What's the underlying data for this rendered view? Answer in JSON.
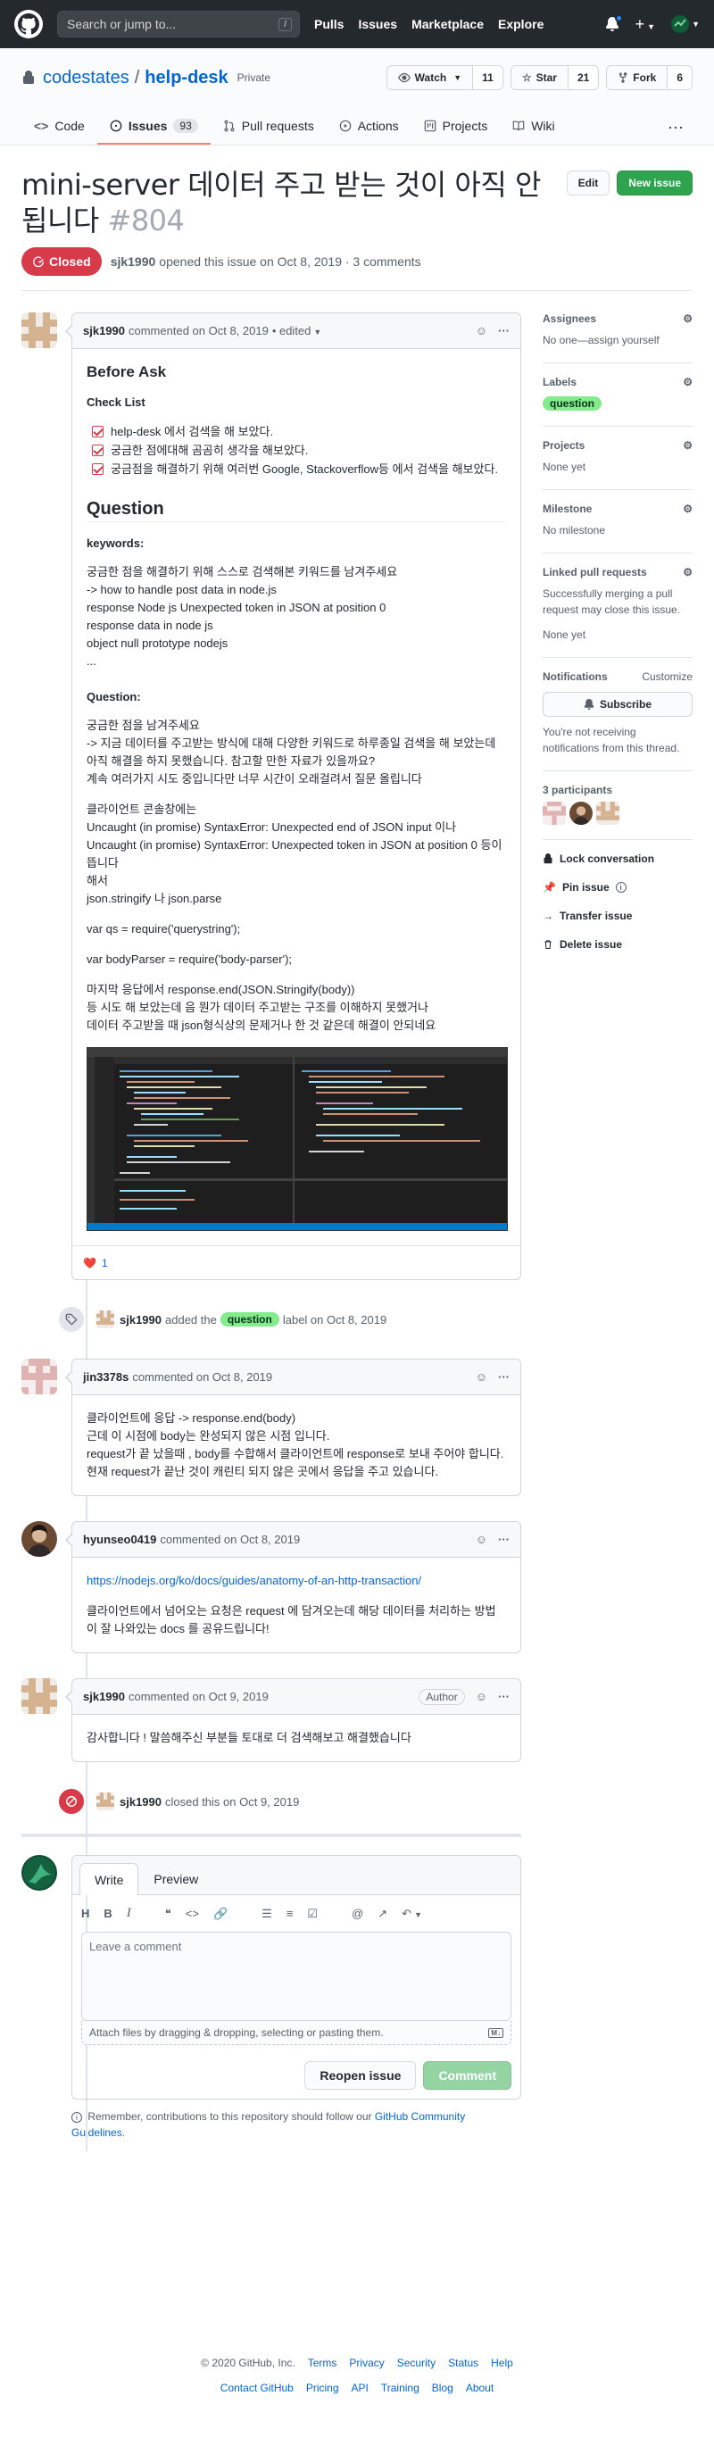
{
  "header": {
    "search_placeholder": "Search or jump to...",
    "slash_key": "/",
    "nav": [
      "Pulls",
      "Issues",
      "Marketplace",
      "Explore"
    ]
  },
  "repo": {
    "owner": "codestates",
    "separator": "/",
    "name": "help-desk",
    "visibility": "Private",
    "watch_label": "Watch",
    "watch_count": "11",
    "star_label": "Star",
    "star_count": "21",
    "fork_label": "Fork",
    "fork_count": "6",
    "tabs": [
      {
        "label": "Code",
        "icon": "code-icon"
      },
      {
        "label": "Issues",
        "icon": "issue-opened-icon",
        "count": "93"
      },
      {
        "label": "Pull requests",
        "icon": "pull-request-icon"
      },
      {
        "label": "Actions",
        "icon": "play-icon"
      },
      {
        "label": "Projects",
        "icon": "project-icon"
      },
      {
        "label": "Wiki",
        "icon": "book-icon"
      }
    ]
  },
  "issue": {
    "title": "mini-server 데이터 주고 받는 것이 아직 안됩니다",
    "number": "#804",
    "edit_label": "Edit",
    "new_issue_label": "New issue",
    "state": "Closed",
    "author": "sjk1990",
    "meta": "opened this issue on Oct 8, 2019 · 3 comments"
  },
  "first_comment": {
    "user": "sjk1990",
    "meta": "commented on Oct 8, 2019",
    "edited": "• edited",
    "before_ask": "Before Ask",
    "check_list_title": "Check List",
    "checks": [
      "help-desk 에서 검색을 해 보았다.",
      "궁금한 점에대해 곰곰히 생각을 해보았다.",
      "궁금점을 해결하기 위해 여러번 Google, Stackoverflow등 에서 검색을 해보았다."
    ],
    "question_heading": "Question",
    "keywords_title": "keywords:",
    "keywords_lines": [
      "궁금한 점을 해결하기 위해 스스로 검색해본 키워드를 남겨주세요",
      "-> how to handle post data in node.js",
      "response Node js Unexpected token in JSON at position 0",
      "response data in node js",
      "object null prototype nodejs",
      "..."
    ],
    "question_title": "Question:",
    "question_lines": [
      "궁금한 점을 남겨주세요",
      "-> 지금 데이터를 주고받는 방식에 대해 다양한 키워드로 하루종일 검색을 해 보았는데 아직 해결을 하지 못했습니다. 참고할 만한 자료가 있을까요?",
      "계속 여러가지 시도 중입니다만 너무 시간이 오래걸려서 질문 올립니다"
    ],
    "client_lines": [
      "클라이언트 콘솔창에는",
      "Uncaught (in promise) SyntaxError: Unexpected end of JSON input 이나",
      "Uncaught (in promise) SyntaxError: Unexpected token in JSON at position 0 등이 뜹니다",
      "해서",
      "json.stringify 나 json.parse"
    ],
    "qs_line": "var qs = require('querystring');",
    "bodyparser_line": "var bodyParser = require('body-parser');",
    "final_lines": [
      "마지막 응답에서 response.end(JSON.Stringify(body))",
      "등 시도 해 보았는데 음 뭔가 데이터 주고받는 구조를 이해하지 못했거나",
      "데이터 주고받을 때 json형식상의 문제거나 한 것 같은데 해결이 안되네요"
    ],
    "reaction_emoji": "❤️",
    "reaction_count": "1"
  },
  "label_event": {
    "user": "sjk1990",
    "text_before": "added the",
    "label": "question",
    "text_after": "label on Oct 8, 2019"
  },
  "comment2": {
    "user": "jin3378s",
    "meta": "commented on Oct 8, 2019",
    "lines": [
      "클라이언트에 응답 -> response.end(body)",
      "근데 이 시점에 body는 완성되지 않은 시점 입니다.",
      "request가 끝 났을때 , body를 수합해서 클라이언트에 response로 보내 주어야 합니다.",
      "현재 request가 끝난 것이 캐린티 되지 않은 곳에서 응답을 주고 있습니다."
    ]
  },
  "comment3": {
    "user": "hyunseo0419",
    "meta": "commented on Oct 8, 2019",
    "link": "https://nodejs.org/ko/docs/guides/anatomy-of-an-http-transaction/",
    "text": "클라이언트에서 넘어오는 요청은 request 에 담겨오는데 해당 데이터를 처리하는 방법이 잘 나와있는 docs 를 공유드립니다!"
  },
  "comment4": {
    "user": "sjk1990",
    "meta": "commented on Oct 9, 2019",
    "badge": "Author",
    "text": "감사합니다 ! 말씀해주신 부분들 토대로 더 검색해보고 해결했습니다"
  },
  "closed_event": {
    "user": "sjk1990",
    "text": "closed this on Oct 9, 2019"
  },
  "new_comment": {
    "tab_write": "Write",
    "tab_preview": "Preview",
    "placeholder": "Leave a comment",
    "attach_text": "Attach files by dragging & dropping, selecting or pasting them.",
    "reopen_label": "Reopen issue",
    "comment_label": "Comment",
    "note_prefix": "Remember, contributions to this repository should follow our",
    "note_link": "GitHub Community Guidelines",
    "note_suffix": "."
  },
  "sidebar": {
    "assignees_title": "Assignees",
    "assignees_value": "No one—assign yourself",
    "labels_title": "Labels",
    "label_value": "question",
    "projects_title": "Projects",
    "projects_value": "None yet",
    "milestone_title": "Milestone",
    "milestone_value": "No milestone",
    "linked_title": "Linked pull requests",
    "linked_desc": "Successfully merging a pull request may close this issue.",
    "linked_value": "None yet",
    "notifications_title": "Notifications",
    "customize": "Customize",
    "subscribe": "Subscribe",
    "notif_desc": "You're not receiving notifications from this thread.",
    "participants_title": "3 participants",
    "lock": "Lock conversation",
    "pin": "Pin issue",
    "transfer": "Transfer issue",
    "delete": "Delete issue"
  },
  "footer": {
    "copyright": "© 2020 GitHub, Inc.",
    "row1": [
      "Terms",
      "Privacy",
      "Security",
      "Status",
      "Help"
    ],
    "row2": [
      "Contact GitHub",
      "Pricing",
      "API",
      "Training",
      "Blog",
      "About"
    ]
  },
  "colors": {
    "closed": "#d73a49",
    "green_button": "#2ea44f",
    "label_question": "#84eb8c",
    "header_bg": "#24292e",
    "link": "#0366d6"
  }
}
